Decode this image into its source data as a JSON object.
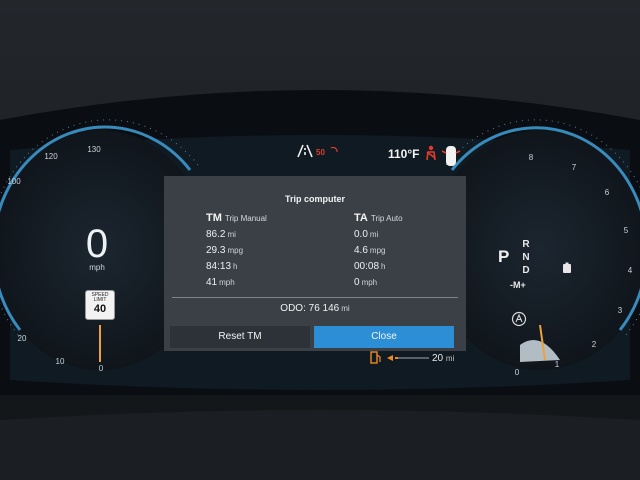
{
  "topbar": {
    "speed_limit_badge": "50",
    "outside_temp": "110°F"
  },
  "speedometer": {
    "speed_value": "0",
    "speed_unit": "mph",
    "speed_limit_sign": {
      "label": "SPEED LIMIT",
      "value": "40"
    },
    "scale_labels": [
      "130",
      "120",
      "100",
      "20",
      "10",
      "0"
    ]
  },
  "tachometer": {
    "scale_labels": [
      "8",
      "7",
      "6",
      "5",
      "4",
      "3",
      "2",
      "1",
      "0"
    ]
  },
  "gear": {
    "current": "P",
    "column": [
      "R",
      "N",
      "D"
    ],
    "manual": "-M+"
  },
  "fuel": {
    "range_value": "20",
    "range_unit": "mi"
  },
  "trip_computer": {
    "title": "Trip computer",
    "trip_manual": {
      "abbr": "TM",
      "name": "Trip Manual",
      "rows": [
        {
          "value": "86.2",
          "unit": "mi"
        },
        {
          "value": "29.3",
          "unit": "mpg"
        },
        {
          "value": "84:13",
          "unit": "h"
        },
        {
          "value": "41",
          "unit": "mph"
        }
      ]
    },
    "trip_auto": {
      "abbr": "TA",
      "name": "Trip Auto",
      "rows": [
        {
          "value": "0.0",
          "unit": "mi"
        },
        {
          "value": "4.6",
          "unit": "mpg"
        },
        {
          "value": "00:08",
          "unit": "h"
        },
        {
          "value": "0",
          "unit": "mph"
        }
      ]
    },
    "odo": {
      "label": "ODO:",
      "value": "76 146",
      "unit": "mi"
    },
    "buttons": {
      "reset": "Reset TM",
      "close": "Close"
    }
  },
  "colors": {
    "panel_bg": "#3a4046",
    "close_button": "#2c8fd6",
    "dial_accent": "#3fa0d8",
    "warning_red": "#e23b2e",
    "fuel_warning": "#f08a1e"
  },
  "icons": [
    "lane-assist-icon",
    "speed-camera-icon",
    "seatbelt-warning-icon",
    "car-door-open-icon",
    "fuel-pump-icon",
    "auto-hold-icon"
  ]
}
